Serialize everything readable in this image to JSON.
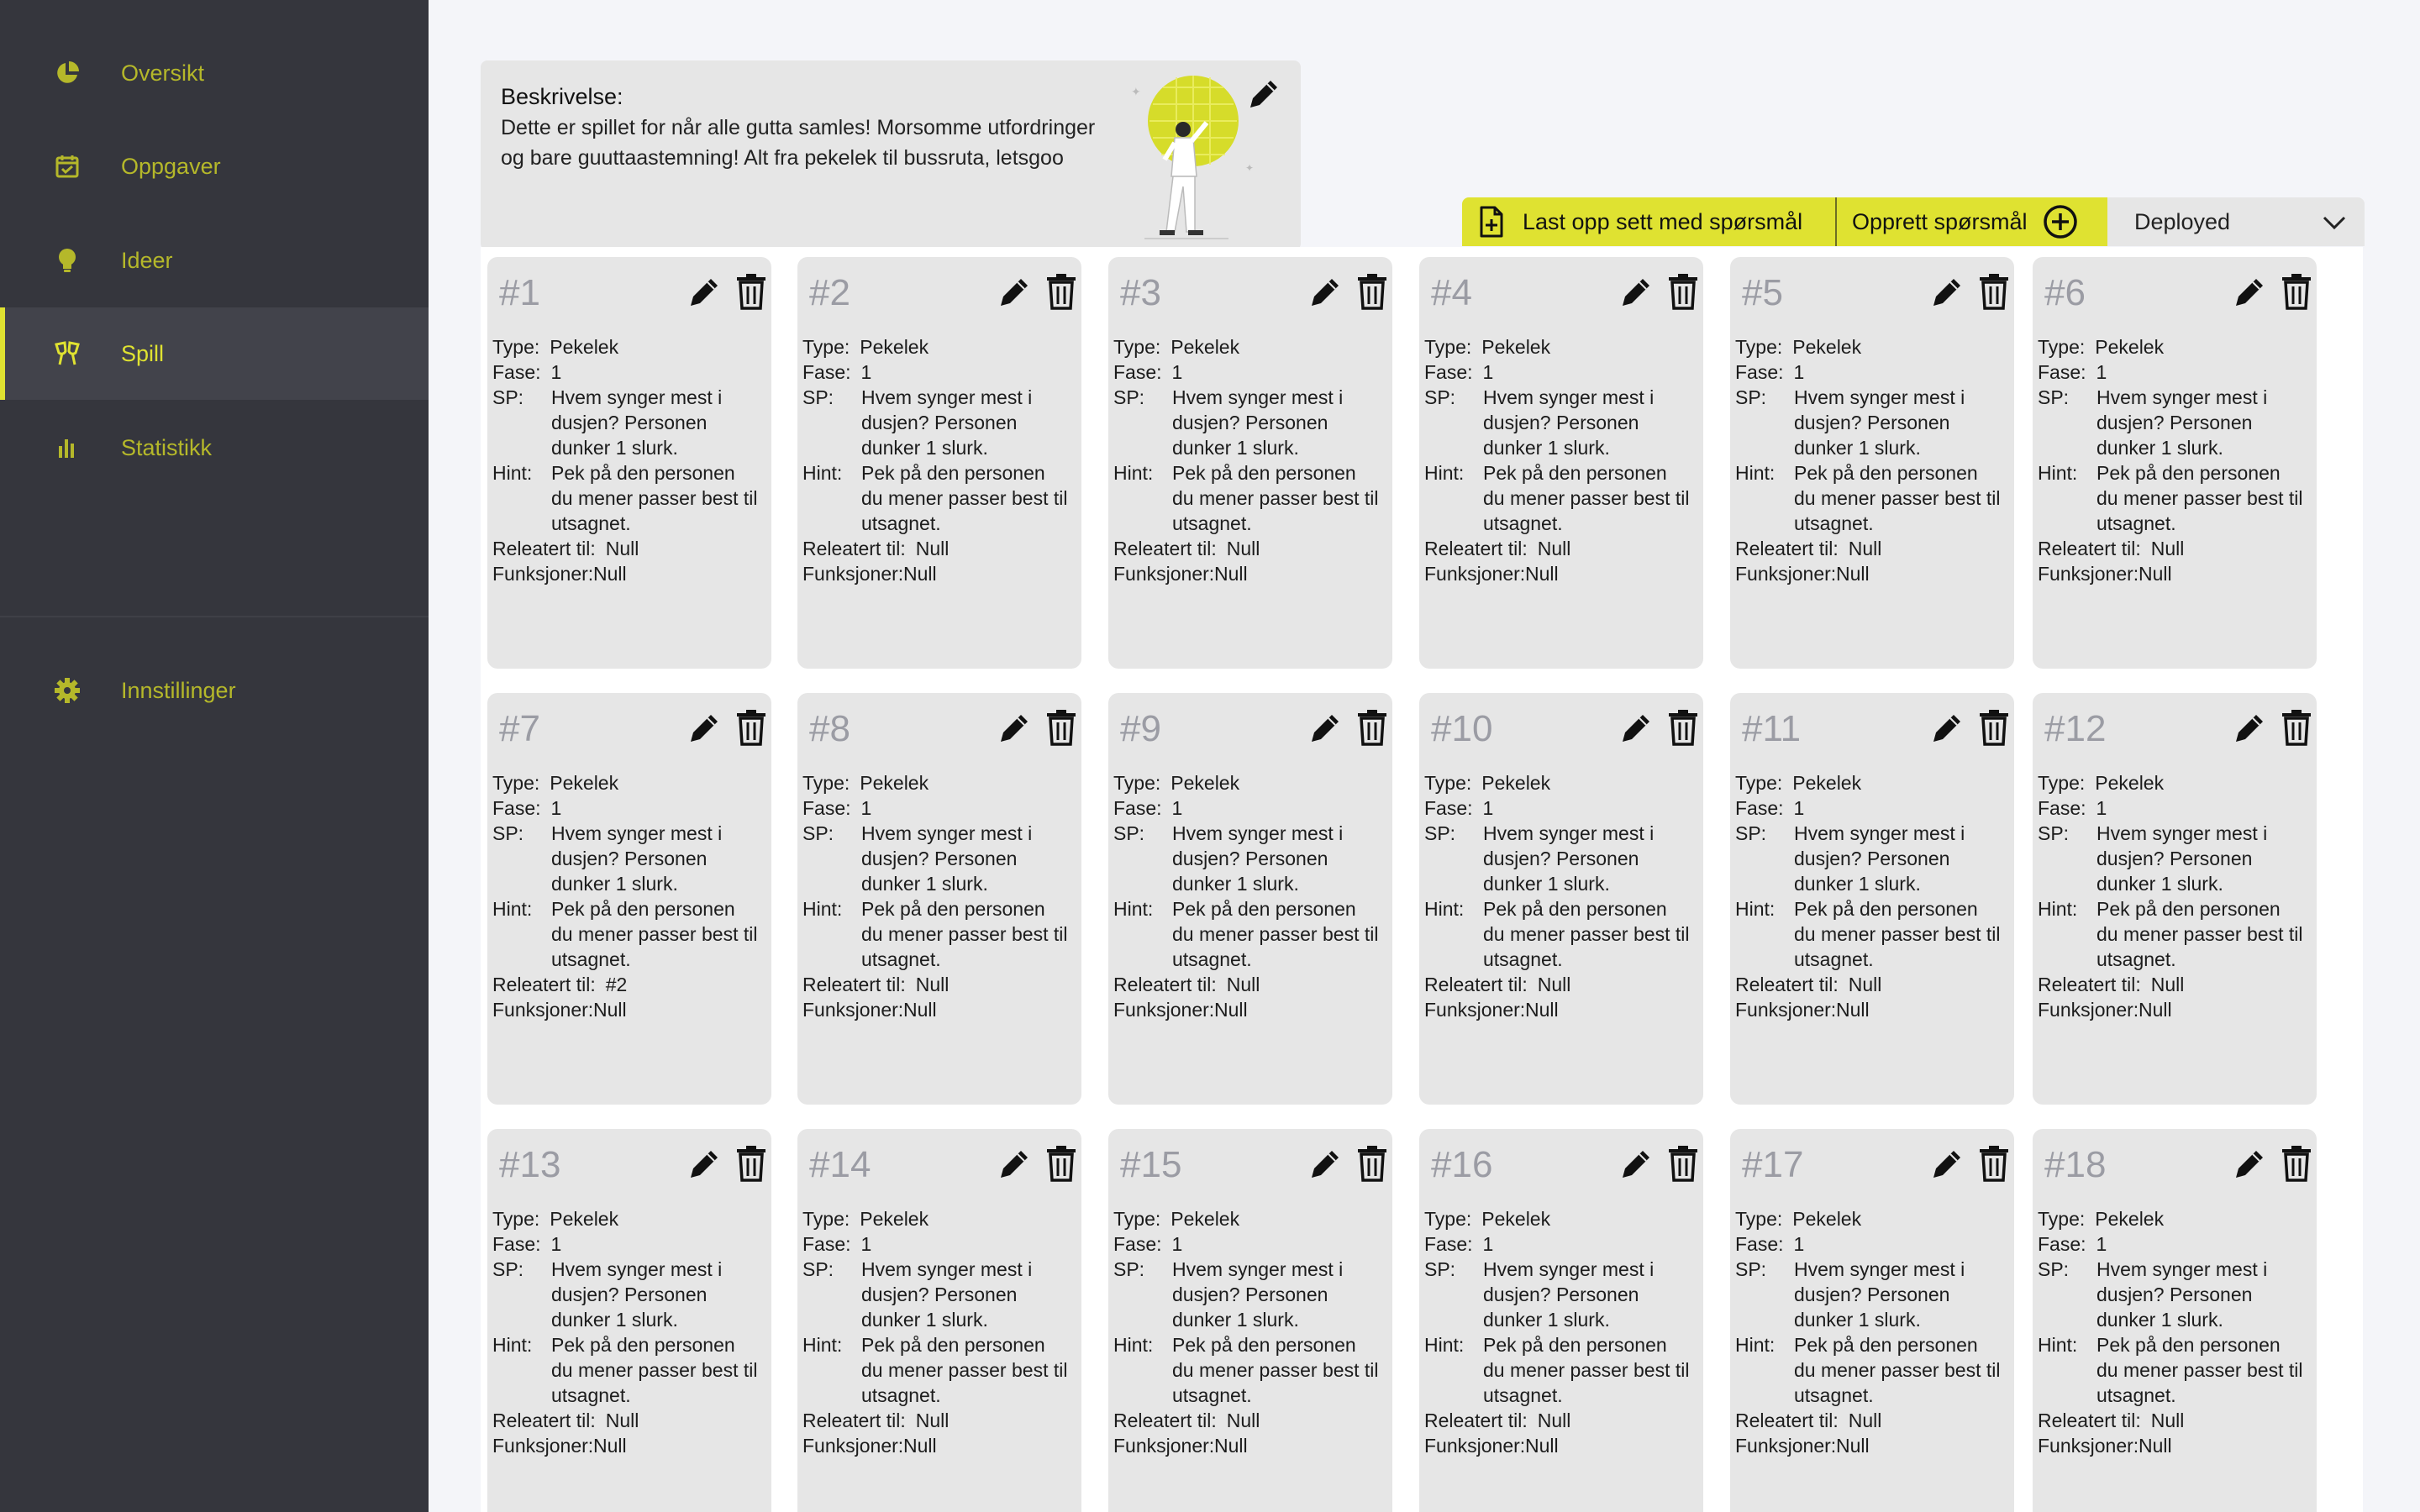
{
  "colors": {
    "accent": "#dfe231",
    "sidebar_bg": "#35363d",
    "card_bg": "#e6e6e6",
    "card_number": "#9b9ca4"
  },
  "sidebar": {
    "items": [
      {
        "label": "Oversikt",
        "icon": "pie-chart-icon",
        "active": false
      },
      {
        "label": "Oppgaver",
        "icon": "calendar-check-icon",
        "active": false
      },
      {
        "label": "Ideer",
        "icon": "lightbulb-icon",
        "active": false
      },
      {
        "label": "Spill",
        "icon": "cheers-icon",
        "active": true
      },
      {
        "label": "Statistikk",
        "icon": "bar-chart-icon",
        "active": false
      }
    ],
    "settings": {
      "label": "Innstillinger",
      "icon": "gear-icon"
    }
  },
  "description": {
    "title": "Beskrivelse:",
    "text": "Dette er spillet for når alle gutta samles! Morsomme utfordringer og bare guuttaastemning! Alt fra pekelek til bussruta, letsgoo"
  },
  "toolbar": {
    "upload_label": "Last opp sett med spørsmål",
    "create_label": "Opprett spørsmål",
    "status_value": "Deployed"
  },
  "card_labels": {
    "type": "Type:",
    "fase": "Fase:",
    "sp": "SP:",
    "hint": "Hint:",
    "related": "Releatert til:",
    "functions": "Funksjoner:"
  },
  "cards": [
    {
      "number": "#1",
      "type": "Pekelek",
      "fase": "1",
      "sp": "Hvem synger mest i dusjen? Personen dunker 1 slurk.",
      "hint": "Pek på den personen du mener passer best til utsagnet.",
      "related": "Null",
      "functions": "Null"
    },
    {
      "number": "#2",
      "type": "Pekelek",
      "fase": "1",
      "sp": "Hvem synger mest i dusjen? Personen dunker 1 slurk.",
      "hint": "Pek på den personen du mener passer best til utsagnet.",
      "related": "Null",
      "functions": "Null"
    },
    {
      "number": "#3",
      "type": "Pekelek",
      "fase": "1",
      "sp": "Hvem synger mest i dusjen? Personen dunker 1 slurk.",
      "hint": "Pek på den personen du mener passer best til utsagnet.",
      "related": "Null",
      "functions": "Null"
    },
    {
      "number": "#4",
      "type": "Pekelek",
      "fase": "1",
      "sp": "Hvem synger mest i dusjen? Personen dunker 1 slurk.",
      "hint": "Pek på den personen du mener passer best til utsagnet.",
      "related": "Null",
      "functions": "Null"
    },
    {
      "number": "#5",
      "type": "Pekelek",
      "fase": "1",
      "sp": "Hvem synger mest i dusjen? Personen dunker 1 slurk.",
      "hint": "Pek på den personen du mener passer best til utsagnet.",
      "related": "Null",
      "functions": "Null"
    },
    {
      "number": "#6",
      "type": "Pekelek",
      "fase": "1",
      "sp": "Hvem synger mest i dusjen? Personen dunker 1 slurk.",
      "hint": "Pek på den personen du mener passer best til utsagnet.",
      "related": "Null",
      "functions": "Null"
    },
    {
      "number": "#7",
      "type": "Pekelek",
      "fase": "1",
      "sp": "Hvem synger mest i dusjen? Personen dunker 1 slurk.",
      "hint": "Pek på den personen du mener passer best til utsagnet.",
      "related": "#2",
      "functions": "Null"
    },
    {
      "number": "#8",
      "type": "Pekelek",
      "fase": "1",
      "sp": "Hvem synger mest i dusjen? Personen dunker 1 slurk.",
      "hint": "Pek på den personen du mener passer best til utsagnet.",
      "related": "Null",
      "functions": "Null"
    },
    {
      "number": "#9",
      "type": "Pekelek",
      "fase": "1",
      "sp": "Hvem synger mest i dusjen? Personen dunker 1 slurk.",
      "hint": "Pek på den personen du mener passer best til utsagnet.",
      "related": "Null",
      "functions": "Null"
    },
    {
      "number": "#10",
      "type": "Pekelek",
      "fase": "1",
      "sp": "Hvem synger mest i dusjen? Personen dunker 1 slurk.",
      "hint": "Pek på den personen du mener passer best til utsagnet.",
      "related": "Null",
      "functions": "Null"
    },
    {
      "number": "#11",
      "type": "Pekelek",
      "fase": "1",
      "sp": "Hvem synger mest i dusjen? Personen dunker 1 slurk.",
      "hint": "Pek på den personen du mener passer best til utsagnet.",
      "related": "Null",
      "functions": "Null"
    },
    {
      "number": "#12",
      "type": "Pekelek",
      "fase": "1",
      "sp": "Hvem synger mest i dusjen? Personen dunker 1 slurk.",
      "hint": "Pek på den personen du mener passer best til utsagnet.",
      "related": "Null",
      "functions": "Null"
    },
    {
      "number": "#13",
      "type": "Pekelek",
      "fase": "1",
      "sp": "Hvem synger mest i dusjen? Personen dunker 1 slurk.",
      "hint": "Pek på den personen du mener passer best til utsagnet.",
      "related": "Null",
      "functions": "Null"
    },
    {
      "number": "#14",
      "type": "Pekelek",
      "fase": "1",
      "sp": "Hvem synger mest i dusjen? Personen dunker 1 slurk.",
      "hint": "Pek på den personen du mener passer best til utsagnet.",
      "related": "Null",
      "functions": "Null"
    },
    {
      "number": "#15",
      "type": "Pekelek",
      "fase": "1",
      "sp": "Hvem synger mest i dusjen? Personen dunker 1 slurk.",
      "hint": "Pek på den personen du mener passer best til utsagnet.",
      "related": "Null",
      "functions": "Null"
    },
    {
      "number": "#16",
      "type": "Pekelek",
      "fase": "1",
      "sp": "Hvem synger mest i dusjen? Personen dunker 1 slurk.",
      "hint": "Pek på den personen du mener passer best til utsagnet.",
      "related": "Null",
      "functions": "Null"
    },
    {
      "number": "#17",
      "type": "Pekelek",
      "fase": "1",
      "sp": "Hvem synger mest i dusjen? Personen dunker 1 slurk.",
      "hint": "Pek på den personen du mener passer best til utsagnet.",
      "related": "Null",
      "functions": "Null"
    },
    {
      "number": "#18",
      "type": "Pekelek",
      "fase": "1",
      "sp": "Hvem synger mest i dusjen? Personen dunker 1 slurk.",
      "hint": "Pek på den personen du mener passer best til utsagnet.",
      "related": "Null",
      "functions": "Null"
    }
  ]
}
